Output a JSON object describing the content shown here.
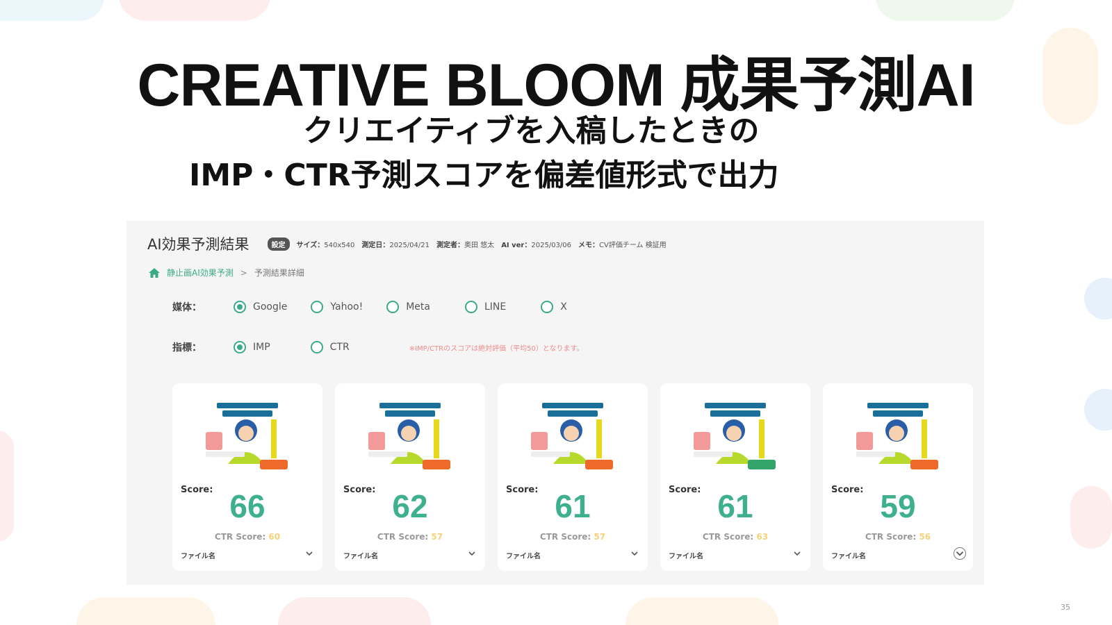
{
  "slide": {
    "title": "CREATIVE BLOOM 成果予測AI",
    "subtitle_line1": "クリエイティブを入稿したときの",
    "subtitle_line2": "IMP・CTR予測スコアを偏差値形式で出力",
    "page_number": "35"
  },
  "panel": {
    "title": "AI効果予測結果",
    "badge": "設定",
    "meta": [
      {
        "label": "サイズ：",
        "value": "540x540"
      },
      {
        "label": "測定日：",
        "value": "2025/04/21"
      },
      {
        "label": "測定者：",
        "value": "奥田 悠太"
      },
      {
        "label": "AI ver：",
        "value": "2025/03/06"
      },
      {
        "label": "メモ：",
        "value": "CV評価チーム 検証用"
      }
    ],
    "breadcrumb": {
      "link": "静止画AI効果予測",
      "separator": ">",
      "current": "予測結果詳細"
    },
    "media": {
      "label": "媒体：",
      "options": [
        "Google",
        "Yahoo!",
        "Meta",
        "LINE",
        "X"
      ],
      "selected": 0
    },
    "metric": {
      "label": "指標：",
      "options": [
        "IMP",
        "CTR"
      ],
      "selected": 0,
      "note": "※IMP/CTRのスコアは絶対評価（平均50）となります。"
    },
    "cards": [
      {
        "score_label": "Score:",
        "score": "66",
        "ctr_label": "CTR Score:",
        "ctr": "60",
        "file_label": "ファイル名"
      },
      {
        "score_label": "Score:",
        "score": "62",
        "ctr_label": "CTR Score:",
        "ctr": "57",
        "file_label": "ファイル名"
      },
      {
        "score_label": "Score:",
        "score": "61",
        "ctr_label": "CTR Score:",
        "ctr": "57",
        "file_label": "ファイル名"
      },
      {
        "score_label": "Score:",
        "score": "61",
        "ctr_label": "CTR Score:",
        "ctr": "63",
        "file_label": "ファイル名"
      },
      {
        "score_label": "Score:",
        "score": "59",
        "ctr_label": "CTR Score:",
        "ctr": "56",
        "file_label": "ファイル名"
      }
    ]
  },
  "colors": {
    "accent": "#3aaa89",
    "score": "#3fb08e",
    "ctr_value": "#f5d27a",
    "note": "#f08a8a"
  }
}
